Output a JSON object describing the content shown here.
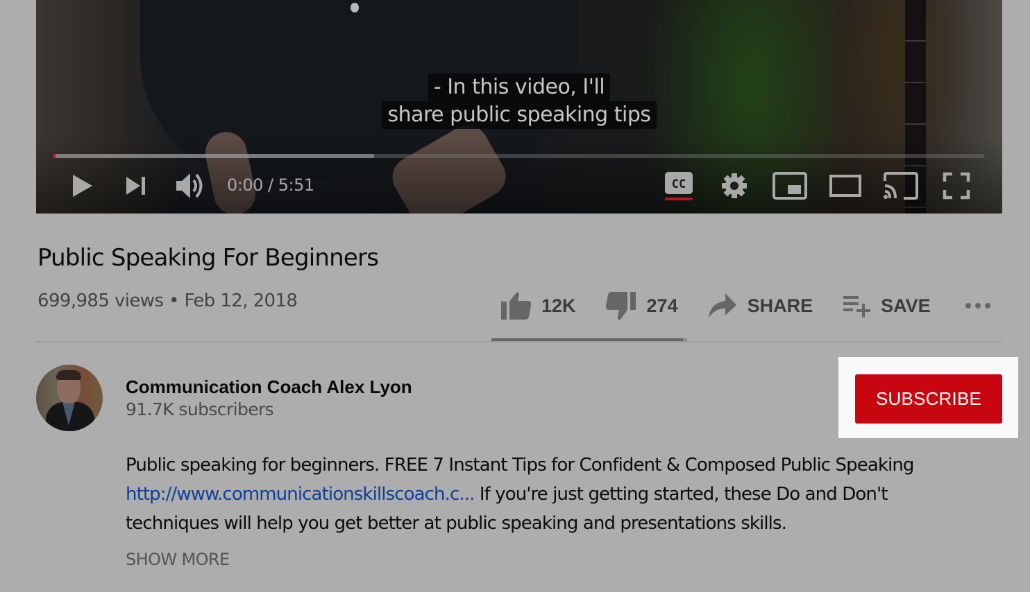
{
  "player": {
    "captions": [
      "- In this video, I'll",
      "share public speaking tips"
    ],
    "time_current": "0:00",
    "time_total": "5:51",
    "time_display": "0:00 / 5:51",
    "progress_played_fraction": 0.003,
    "progress_buffered_fraction": 0.345,
    "captions_enabled": true,
    "controls": {
      "play": "play-icon",
      "next": "next-icon",
      "volume": "volume-icon",
      "subtitles": "cc-icon",
      "settings": "gear-icon",
      "miniplayer": "miniplayer-icon",
      "theater": "theater-mode-icon",
      "cast": "cast-icon",
      "fullscreen": "fullscreen-icon"
    },
    "accent_color": "#c4131b"
  },
  "video": {
    "title": "Public Speaking For Beginners",
    "views": "699,985 views",
    "date": "Feb 12, 2018",
    "meta_line": "699,985 views • Feb 12, 2018"
  },
  "actions": {
    "like_count": "12K",
    "dislike_count": "274",
    "share_label": "SHARE",
    "save_label": "SAVE",
    "more_icon": "more-horizontal-icon",
    "like_ratio": 0.977
  },
  "channel": {
    "name": "Communication Coach Alex Lyon",
    "subscribers": "91.7K subscribers",
    "subscribe_label": "SUBSCRIBE",
    "subscribe_color": "#c8060f"
  },
  "description": {
    "line1": "Public speaking for beginners. FREE 7 Instant Tips for Confident & Composed Public Speaking",
    "link": "http://www.communicationskillscoach.c...",
    "line2_rest": " If you're just getting started, these Do and Don't",
    "line3": "techniques will help you get better at public speaking and presentations skills.",
    "show_more_label": "SHOW MORE"
  }
}
